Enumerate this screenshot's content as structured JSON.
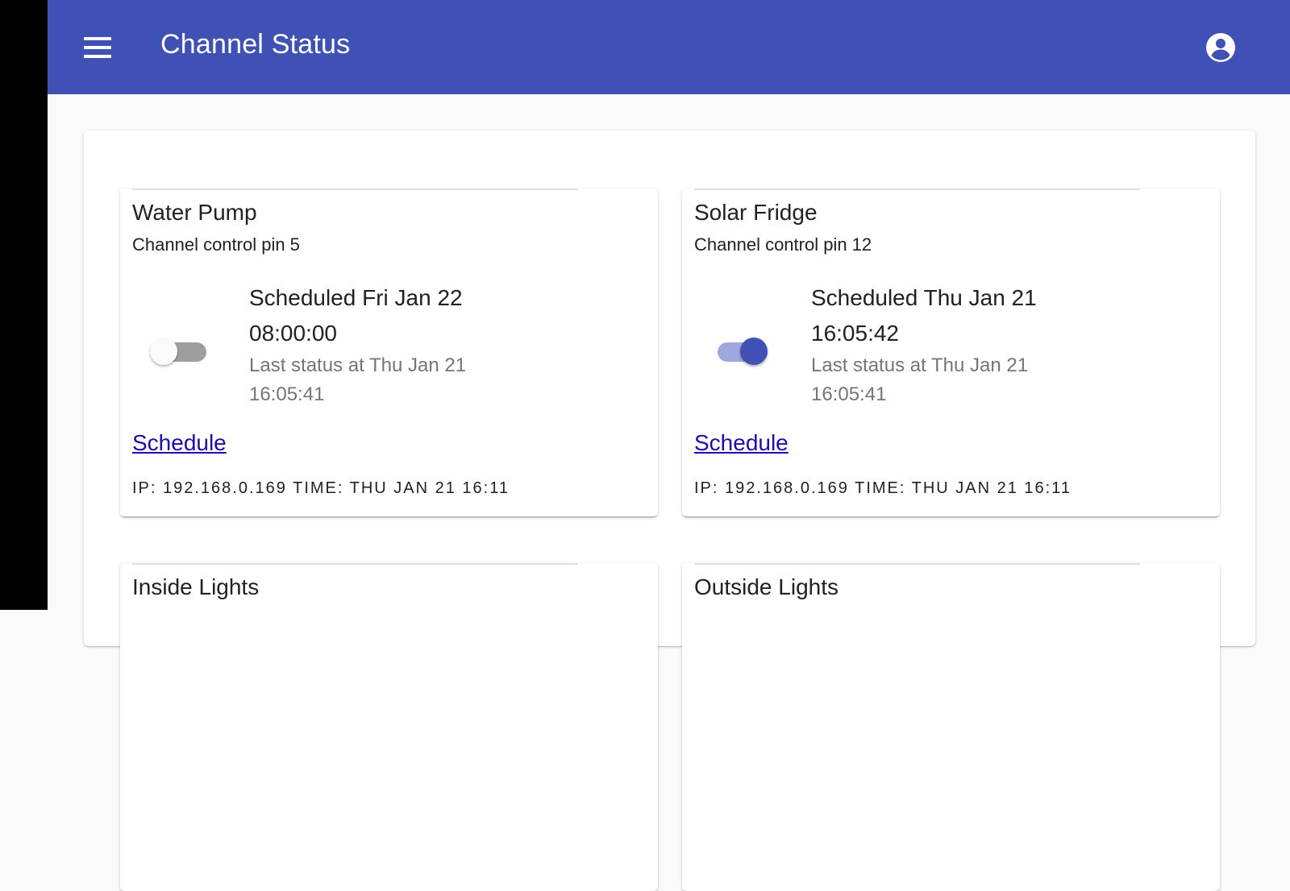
{
  "app_bar": {
    "title": "Channel Status",
    "color": "#3f51b5",
    "menu_icon": "menu-icon",
    "account_icon": "account-circle-icon"
  },
  "channels": [
    {
      "name": "Water Pump",
      "pin": "Channel control pin 5",
      "switch_on": false,
      "scheduled": "Scheduled Fri Jan 22 08:00:00",
      "last_status": "Last status at Thu Jan 21 16:05:41",
      "schedule_link": "Schedule",
      "footer": "IP: 192.168.0.169 TIME: THU JAN 21 16:11"
    },
    {
      "name": "Solar Fridge",
      "pin": "Channel control pin 12",
      "switch_on": true,
      "scheduled": "Scheduled Thu Jan 21 16:05:42",
      "last_status": "Last status at Thu Jan 21 16:05:41",
      "schedule_link": "Schedule",
      "footer": "IP: 192.168.0.169 TIME: THU JAN 21 16:11"
    },
    {
      "name": "Inside Lights"
    },
    {
      "name": "Outside Lights"
    }
  ]
}
